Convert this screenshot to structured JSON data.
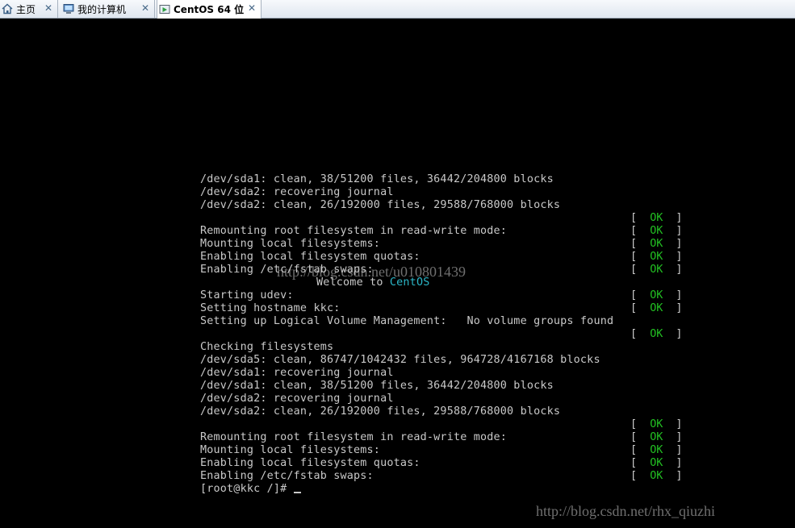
{
  "tabs": [
    {
      "label": "主页",
      "icon": "home-icon"
    },
    {
      "label": "我的计算机",
      "icon": "computer-icon"
    },
    {
      "label": "CentOS 64 位",
      "icon": "vm-icon"
    }
  ],
  "close_glyph": "✕",
  "console": {
    "lines": [
      "/dev/sda1: clean, 38/51200 files, 36442/204800 blocks",
      "/dev/sda2: recovering journal",
      "/dev/sda2: clean, 26/192000 files, 29588/768000 blocks",
      "",
      "Remounting root filesystem in read-write mode:",
      "Mounting local filesystems:",
      "Enabling local filesystem quotas:",
      "Enabling /etc/fstab swaps:",
      "",
      "Starting udev:",
      "Setting hostname kkc:",
      "Setting up Logical Volume Management:   No volume groups found",
      "",
      "Checking filesystems",
      "/dev/sda5: clean, 86747/1042432 files, 964728/4167168 blocks",
      "/dev/sda1: recovering journal",
      "/dev/sda1: clean, 38/51200 files, 36442/204800 blocks",
      "/dev/sda2: recovering journal",
      "/dev/sda2: clean, 26/192000 files, 29588/768000 blocks",
      "",
      "Remounting root filesystem in read-write mode:",
      "Mounting local filesystems:",
      "Enabling local filesystem quotas:",
      "Enabling /etc/fstab swaps:",
      "[root@kkc /]# "
    ],
    "welcome_prefix": "Welcome to ",
    "welcome_name": "CentOS",
    "ok_text": "OK",
    "ok_rows": [
      3,
      4,
      5,
      6,
      7,
      9,
      10,
      12,
      19,
      20,
      21,
      22,
      23
    ]
  },
  "watermarks": {
    "center": "http://blog.csdn.net/u010801439",
    "bottom": "http://blog.csdn.net/rhx_qiuzhi"
  },
  "colors": {
    "ok": "#22c022",
    "welcome": "#2bb7c8",
    "text": "#c9c9c9"
  }
}
